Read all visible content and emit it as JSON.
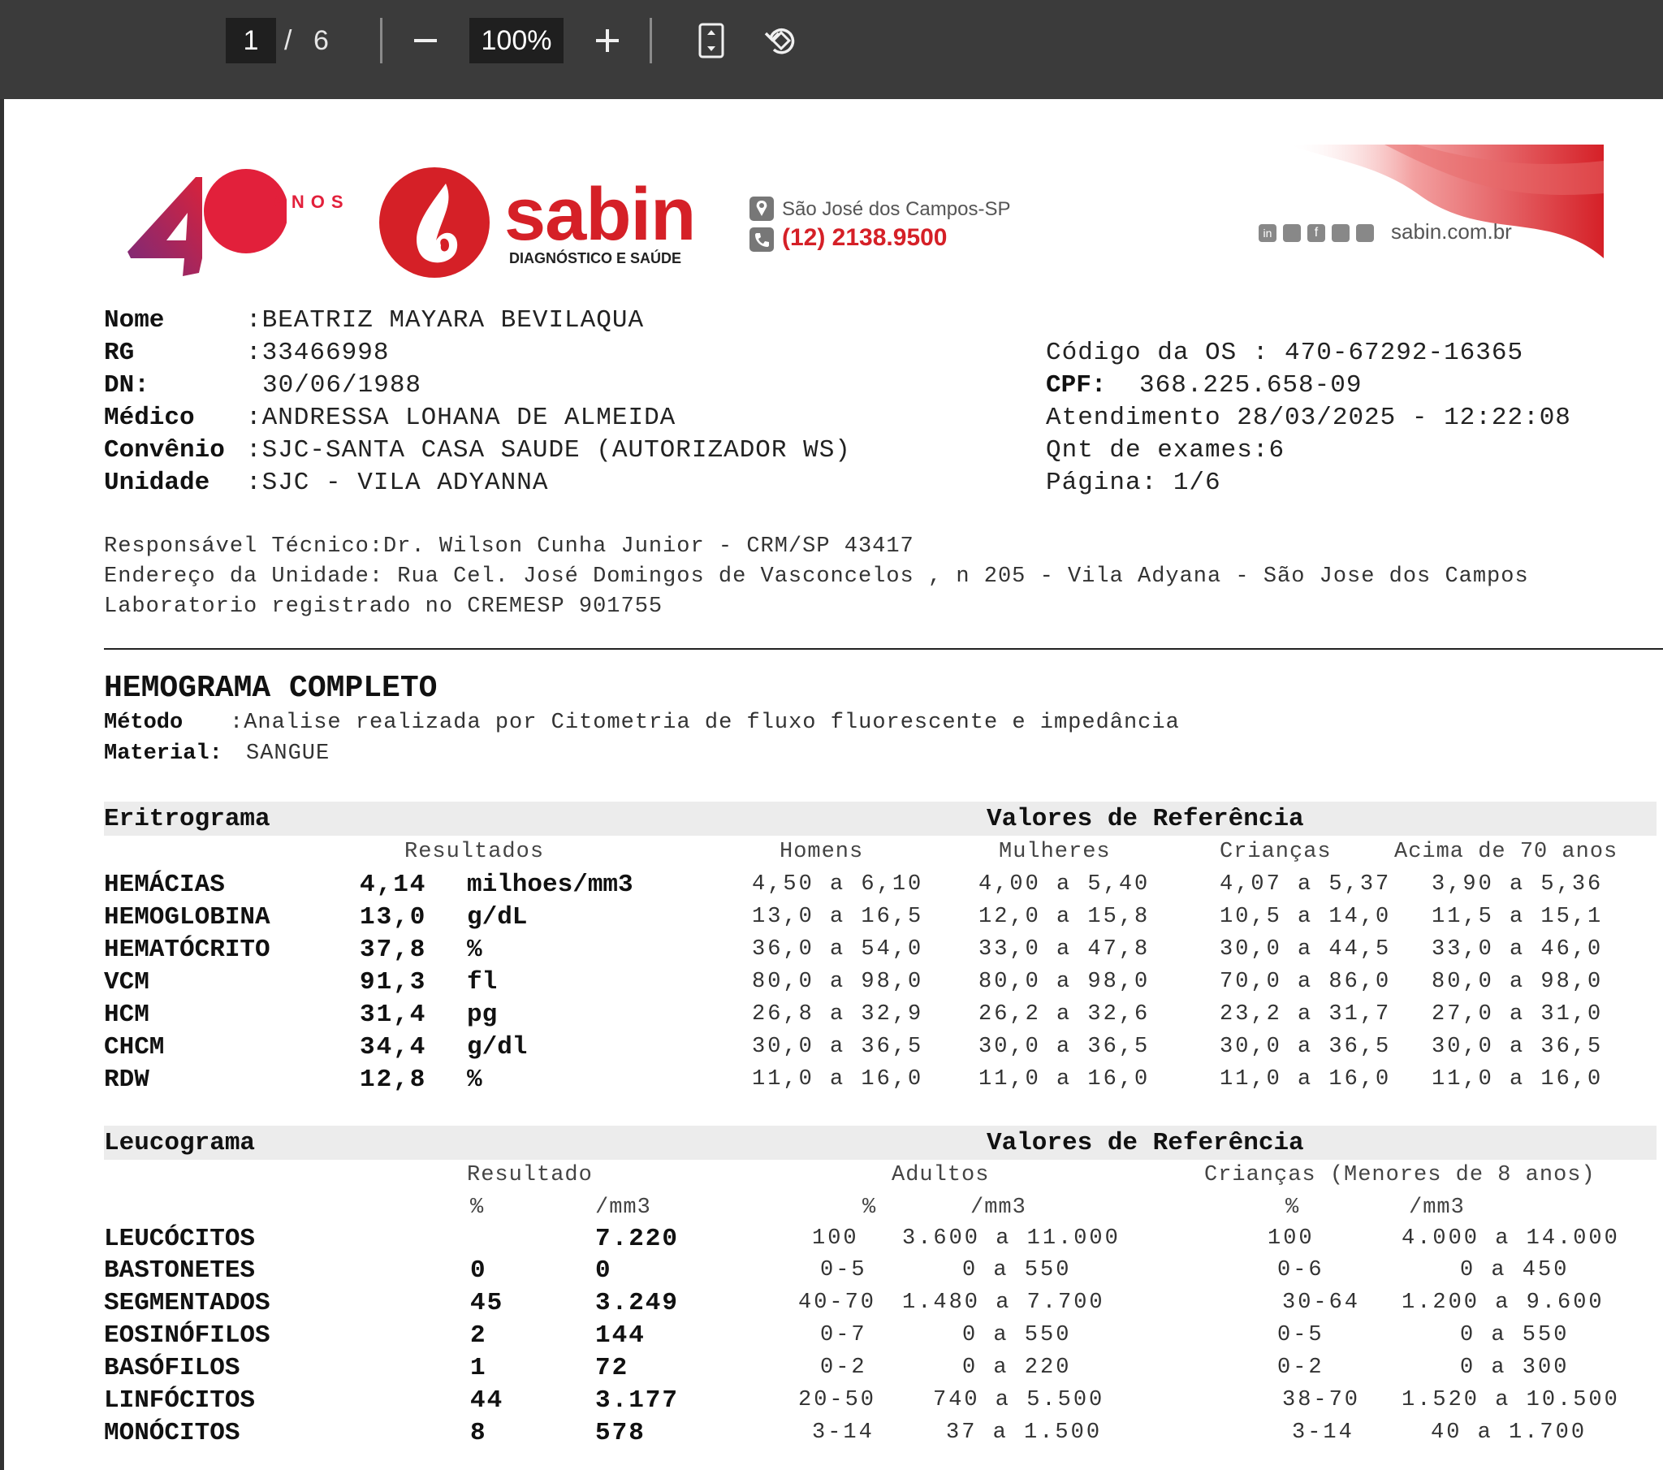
{
  "viewer": {
    "current_page": "1",
    "page_separator": "/",
    "total_pages": "6",
    "zoom": "100%",
    "icons": [
      "zoom-out-icon",
      "zoom-in-icon",
      "fit-page-icon",
      "rotate-icon"
    ]
  },
  "header": {
    "anniversary_number": "40",
    "anniversary_word": "ANOS",
    "brand": "sabin",
    "brand_tagline": "DIAGNÓSTICO E SAÚDE",
    "city": "São José dos Campos-SP",
    "phone": "(12) 2138.9500",
    "website": "sabin.com.br",
    "colors": {
      "brand_red": "#d52027",
      "anniversary_purple": "#8e2b6b"
    }
  },
  "patient": {
    "nome_label": "Nome",
    "nome_value": ":BEATRIZ MAYARA BEVILAQUA",
    "rg_label": "RG",
    "rg_value": ":33466998",
    "dn_label": "DN:",
    "dn_value": "30/06/1988",
    "medico_label": "Médico",
    "medico_value": ":ANDRESSA LOHANA DE ALMEIDA",
    "convenio_label": "Convênio",
    "convenio_value": ":SJC-SANTA CASA SAUDE (AUTORIZADOR WS)",
    "unidade_label": "Unidade",
    "unidade_value": ":SJC - VILA ADYANNA"
  },
  "order": {
    "codigo": "Código da OS :  470-67292-16365",
    "cpf_label": "CPF:",
    "cpf_value": "368.225.658-09",
    "atendimento": "Atendimento  28/03/2025 - 12:22:08",
    "qnt": "Qnt de exames:6",
    "pagina": "Página:  1/6"
  },
  "lab": {
    "responsavel": "Responsável Técnico:Dr. Wilson Cunha Junior - CRM/SP 43417",
    "endereco": "Endereço da Unidade: Rua Cel. José Domingos de Vasconcelos , n 205 - Vila Adyana - São Jose dos Campos",
    "registro": "Laboratorio registrado no CREMESP 901755"
  },
  "exam": {
    "title": "HEMOGRAMA COMPLETO",
    "metodo_label": "Método",
    "metodo_value": ":Analise realizada por Citometria de fluxo fluorescente e impedância",
    "material_label": "Material:",
    "material_value": "SANGUE"
  },
  "eritrograma": {
    "section": "Eritrograma",
    "ref_title": "Valores de Referência",
    "col_resultados": "Resultados",
    "col_homens": "Homens",
    "col_mulheres": "Mulheres",
    "col_criancas": "Crianças",
    "col_70": "Acima de 70 anos",
    "rows": [
      {
        "name": "HEMÁCIAS",
        "value": "4,14",
        "unit": "milhoes/mm3",
        "homens": "4,50 a 6,10",
        "mulheres": "4,00 a 5,40",
        "criancas": "4,07 a 5,37",
        "acima70": "3,90 a 5,36"
      },
      {
        "name": "HEMOGLOBINA",
        "value": "13,0",
        "unit": "g/dL",
        "homens": "13,0 a 16,5",
        "mulheres": "12,0 a 15,8",
        "criancas": "10,5 a 14,0",
        "acima70": "11,5 a 15,1"
      },
      {
        "name": "HEMATÓCRITO",
        "value": "37,8",
        "unit": "%",
        "homens": "36,0 a 54,0",
        "mulheres": "33,0 a 47,8",
        "criancas": "30,0 a 44,5",
        "acima70": "33,0 a 46,0"
      },
      {
        "name": "VCM",
        "value": "91,3",
        "unit": "fl",
        "homens": "80,0 a 98,0",
        "mulheres": "80,0 a 98,0",
        "criancas": "70,0 a 86,0",
        "acima70": "80,0 a 98,0"
      },
      {
        "name": "HCM",
        "value": "31,4",
        "unit": "pg",
        "homens": "26,8 a 32,9",
        "mulheres": "26,2 a 32,6",
        "criancas": "23,2 a 31,7",
        "acima70": "27,0 a 31,0"
      },
      {
        "name": "CHCM",
        "value": "34,4",
        "unit": "g/dl",
        "homens": "30,0 a 36,5",
        "mulheres": "30,0 a 36,5",
        "criancas": "30,0 a 36,5",
        "acima70": "30,0 a 36,5"
      },
      {
        "name": "RDW",
        "value": "12,8",
        "unit": "%",
        "homens": "11,0 a 16,0",
        "mulheres": "11,0 a 16,0",
        "criancas": "11,0 a 16,0",
        "acima70": "11,0 a 16,0"
      }
    ]
  },
  "leucograma": {
    "section": "Leucograma",
    "ref_title": "Valores de Referência",
    "col_resultado": "Resultado",
    "col_adultos": "Adultos",
    "col_criancas": "Crianças (Menores de 8 anos)",
    "sub_pct": "%",
    "sub_mm3": "/mm3",
    "rows": [
      {
        "name": "LEUCÓCITOS",
        "pct": "",
        "mm3": "7.220",
        "ad_pct": "100",
        "ad_range": "3.600 a 11.000",
        "cr_pct": "100",
        "cr_range": "4.000 a 14.000"
      },
      {
        "name": "BASTONETES",
        "pct": "0",
        "mm3": "0",
        "ad_pct": "0-5",
        "ad_range": "0 a 550",
        "cr_pct": "0-6",
        "cr_range": "0 a 450"
      },
      {
        "name": "SEGMENTADOS",
        "pct": "45",
        "mm3": "3.249",
        "ad_pct": "40-70",
        "ad_range": "1.480 a 7.700",
        "cr_pct": "30-64",
        "cr_range": "1.200 a 9.600"
      },
      {
        "name": "EOSINÓFILOS",
        "pct": "2",
        "mm3": "144",
        "ad_pct": "0-7",
        "ad_range": "0 a 550",
        "cr_pct": "0-5",
        "cr_range": "0 a 550"
      },
      {
        "name": "BASÓFILOS",
        "pct": "1",
        "mm3": "72",
        "ad_pct": "0-2",
        "ad_range": "0 a 220",
        "cr_pct": "0-2",
        "cr_range": "0 a 300"
      },
      {
        "name": "LINFÓCITOS",
        "pct": "44",
        "mm3": "3.177",
        "ad_pct": "20-50",
        "ad_range": "740 a  5.500",
        "cr_pct": "38-70",
        "cr_range": "1.520 a 10.500"
      },
      {
        "name": "MONÓCITOS",
        "pct": "8",
        "mm3": "578",
        "ad_pct": "3-14",
        "ad_range": "37 a 1.500",
        "cr_pct": "3-14",
        "cr_range": "40 a 1.700"
      }
    ]
  }
}
